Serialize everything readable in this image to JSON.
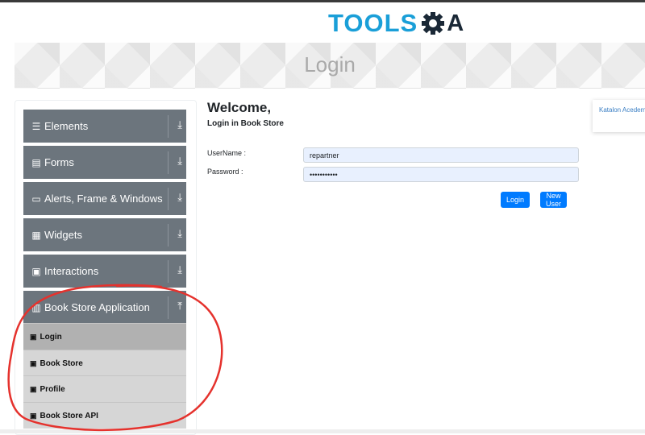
{
  "header": {
    "logo_text": "TOOLS",
    "logo_suffix": "A"
  },
  "banner": {
    "title": "Login"
  },
  "sidebar": {
    "groups": [
      {
        "label": "Elements",
        "icon": "hamburger-icon"
      },
      {
        "label": "Forms",
        "icon": "form-icon"
      },
      {
        "label": "Alerts, Frame & Windows",
        "icon": "window-icon"
      },
      {
        "label": "Widgets",
        "icon": "grid-icon"
      },
      {
        "label": "Interactions",
        "icon": "interaction-icon"
      },
      {
        "label": "Book Store Application",
        "icon": "books-icon",
        "expanded": true
      }
    ],
    "book_store_items": [
      {
        "label": "Login",
        "active": true
      },
      {
        "label": "Book Store",
        "active": false
      },
      {
        "label": "Profile",
        "active": false
      },
      {
        "label": "Book Store API",
        "active": false
      }
    ]
  },
  "login": {
    "welcome": "Welcome,",
    "subtitle": "Login in Book Store",
    "username_label": "UserName :",
    "username_value": "repartner",
    "password_label": "Password :",
    "password_value": "•••••••••••",
    "login_button": "Login",
    "new_user_button": "New User"
  },
  "ad": {
    "alt_text": "Katalon Acedemy"
  },
  "colors": {
    "accent": "#007bff",
    "sidebar_group": "#6c757d",
    "input_bg": "#e8f0fe",
    "annotation": "#e5322d"
  }
}
